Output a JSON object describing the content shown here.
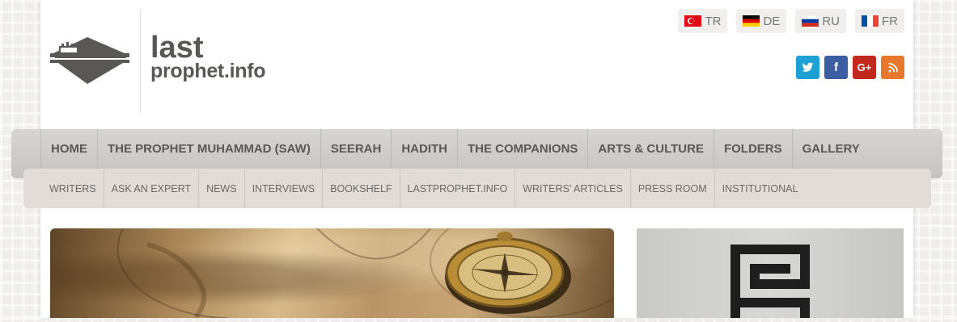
{
  "header": {
    "logo_line1": "last",
    "logo_line2": "prophet.info"
  },
  "languages": [
    {
      "code": "TR",
      "flag": "turkey-flag"
    },
    {
      "code": "DE",
      "flag": "germany-flag"
    },
    {
      "code": "RU",
      "flag": "russia-flag"
    },
    {
      "code": "FR",
      "flag": "france-flag"
    }
  ],
  "social": [
    {
      "icon": "twitter-icon",
      "glyph": "🐦",
      "color": "#1da1d5"
    },
    {
      "icon": "facebook-icon",
      "glyph": "f",
      "color": "#3b5ea3"
    },
    {
      "icon": "google-plus-icon",
      "glyph": "G+",
      "color": "#c0291c"
    },
    {
      "icon": "rss-icon",
      "glyph": "◉",
      "color": "#e8782b"
    }
  ],
  "main_nav": [
    "HOME",
    "THE PROPHET MUHAMMAD (SAW)",
    "SEERAH",
    "HADITH",
    "THE COMPANIONS",
    "ARTS & CULTURE",
    "FOLDERS",
    "GALLERY"
  ],
  "sub_nav": [
    "WRITERS",
    "ASK AN EXPERT",
    "NEWS",
    "INTERVIEWS",
    "BOOKSHELF",
    "LASTPROPHET.INFO",
    "WRITERS' ARTICLES",
    "PRESS ROOM",
    "INSTITUTIONAL"
  ],
  "colors": {
    "logo_text": "#5a5856",
    "nav_bg": "#cfcecc",
    "subnav_bg": "#e1dcd7"
  }
}
